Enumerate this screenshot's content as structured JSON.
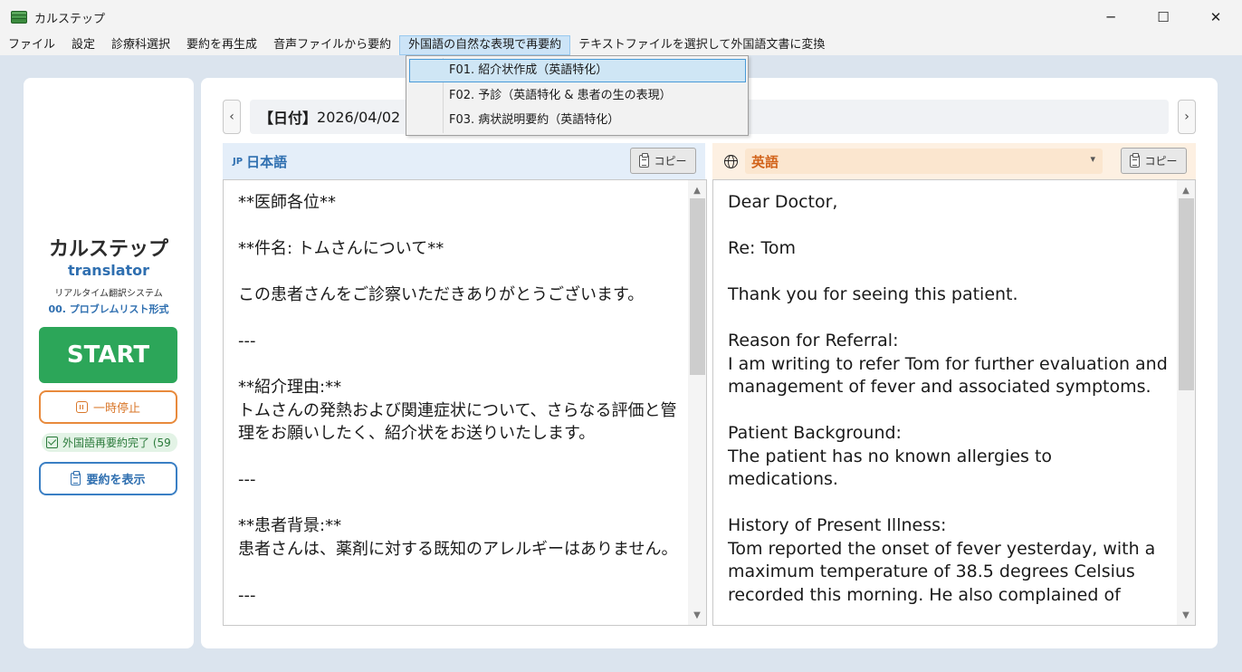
{
  "window": {
    "title": "カルステップ",
    "controls": {
      "minimize": "─",
      "maximize": "☐",
      "close": "✕"
    }
  },
  "menu": {
    "items": [
      {
        "label": "ファイル"
      },
      {
        "label": "設定"
      },
      {
        "label": "診療科選択"
      },
      {
        "label": "要約を再生成"
      },
      {
        "label": "音声ファイルから要約"
      },
      {
        "label": "外国語の自然な表現で再要約"
      },
      {
        "label": "テキストファイルを選択して外国語文書に変換"
      }
    ],
    "dropdown": [
      {
        "label": "F01. 紹介状作成（英語特化）"
      },
      {
        "label": "F02. 予診（英語特化 & 患者の生の表現）"
      },
      {
        "label": "F03. 病状説明要約（英語特化）"
      }
    ]
  },
  "sidebar": {
    "app_name": "カルステップ",
    "app_sub": "translator",
    "description": "リアルタイム翻訳システム",
    "mode": "00. プロブレムリスト形式",
    "start_label": "START",
    "pause_label": "一時停止",
    "status_text": "外国語再要約完了 (59",
    "summary_label": "要約を表示"
  },
  "main": {
    "nav_prev": "‹",
    "nav_next": "›",
    "date_label": "【日付】",
    "date_value": "2026/04/02",
    "jp": {
      "tag": "JP",
      "name": "日本語",
      "copy_label": "コピー",
      "text": "**医師各位**\n\n**件名: トムさんについて**\n\nこの患者さんをご診察いただきありがとうございます。\n\n---\n\n**紹介理由:**\nトムさんの発熱および関連症状について、さらなる評価と管理をお願いしたく、紹介状をお送りいたします。\n\n---\n\n**患者背景:**\n患者さんは、薬剤に対する既知のアレルギーはありません。\n\n---"
    },
    "en": {
      "language": "英語",
      "copy_label": "コピー",
      "text": "Dear Doctor,\n\nRe: Tom\n\nThank you for seeing this patient.\n\nReason for Referral:\nI am writing to refer Tom for further evaluation and management of fever and associated symptoms.\n\nPatient Background:\nThe patient has no known allergies to medications.\n\nHistory of Present Illness:\nTom reported the onset of fever yesterday, with a maximum temperature of 38.5 degrees Celsius recorded this morning. He also complained of"
    }
  },
  "colors": {
    "accent_blue": "#2f6fb0",
    "start_green": "#2ca659",
    "pause_orange": "#e88a3c",
    "en_orange": "#d2631a"
  }
}
